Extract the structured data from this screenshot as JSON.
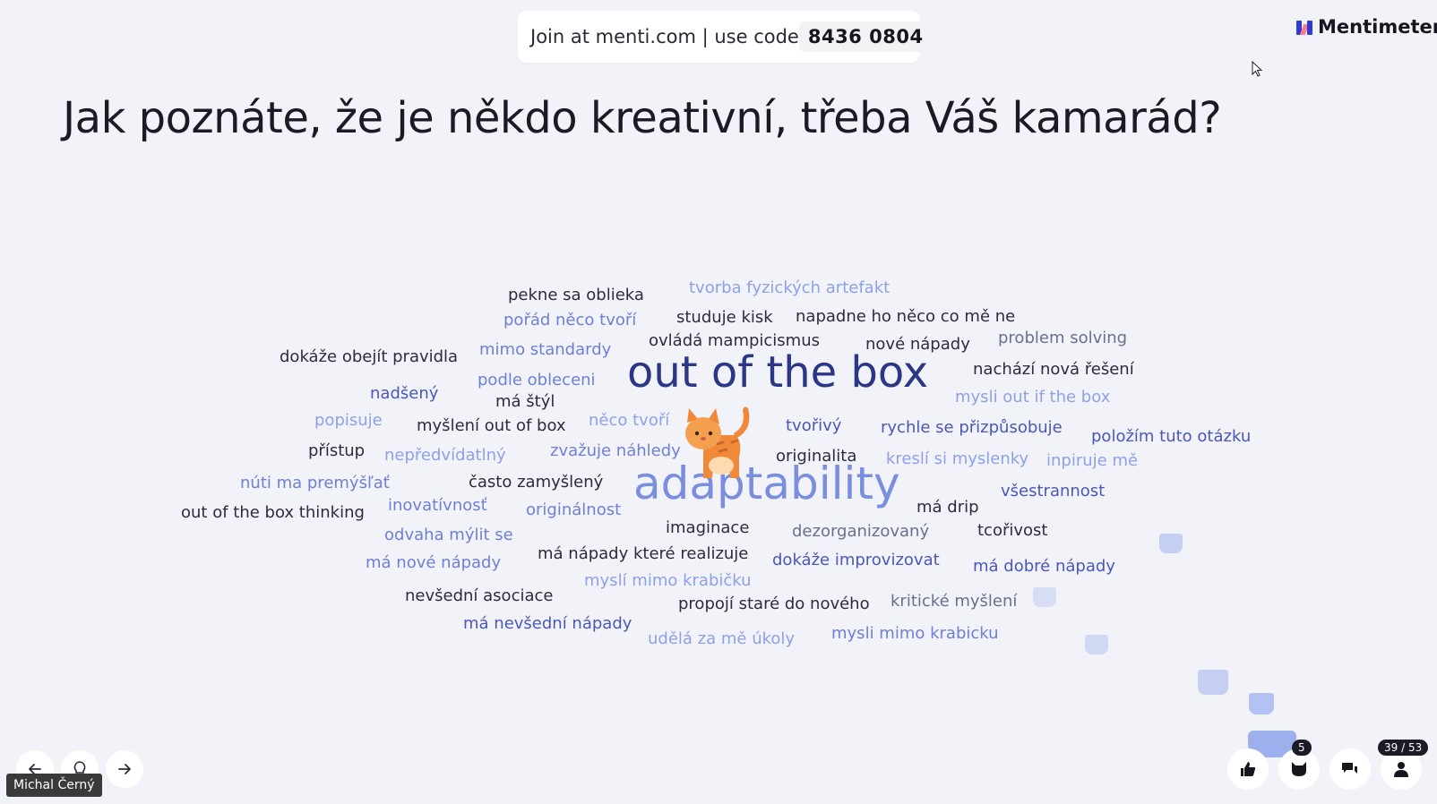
{
  "join_banner": {
    "text": "Join at menti.com | use code",
    "code": "8436 0804"
  },
  "brand": {
    "name": "Mentimeter"
  },
  "question": "Jak poznáte, že je někdo kreativní, třeba Váš kamarád?",
  "word_cloud": {
    "words": [
      "pekne sa oblieka",
      "tvorba fyzických artefakt",
      "pořád něco tvoří",
      "studuje kisk",
      "napadne ho něco co mě ne",
      "dokáže obejít pravidla",
      "mimo standardy",
      "ovládá mampicismus",
      "nové nápady",
      "problem solving",
      "out of the box",
      "nachází nová řešení",
      "podle obleceni",
      "nadšený",
      "má štýl",
      "mysli out if the box",
      "popisuje",
      "myšlení out of box",
      "něco tvoří",
      "tvořivý",
      "rychle se přizpůsobuje",
      "položím tuto otázku",
      "přístup",
      "nepředvídatlný",
      "zvažuje náhledy",
      "originalita",
      "kreslí si myslenky",
      "inpiruje mě",
      "núti ma premýšľať",
      "často zamyšlený",
      "adaptability",
      "všestrannost",
      "out of the box thinking",
      "inovatívnosť",
      "originálnost",
      "má drip",
      "odvaha mýlit se",
      "imaginace",
      "dezorganizovaný",
      "tcořivost",
      "má nové nápady",
      "má nápady které realizuje",
      "dokáže improvizovat",
      "má dobré nápady",
      "myslí mimo krabičku",
      "nevšední asociace",
      "propojí staré do nového",
      "kritické myšlení",
      "má nevšední nápady",
      "udělá za mě úkoly",
      "mysli mimo krabicku"
    ]
  },
  "controls": {
    "prev_icon": "arrow-left-icon",
    "hint_icon": "lightbulb-icon",
    "next_icon": "arrow-right-icon",
    "presenter_name": "Michal Černý",
    "reactions_count": "5",
    "participants_count": "39 / 53"
  },
  "colors": {
    "background": "#f2f3f8",
    "dark_word": "#2b3685",
    "light_word": "#8ea0e8"
  }
}
